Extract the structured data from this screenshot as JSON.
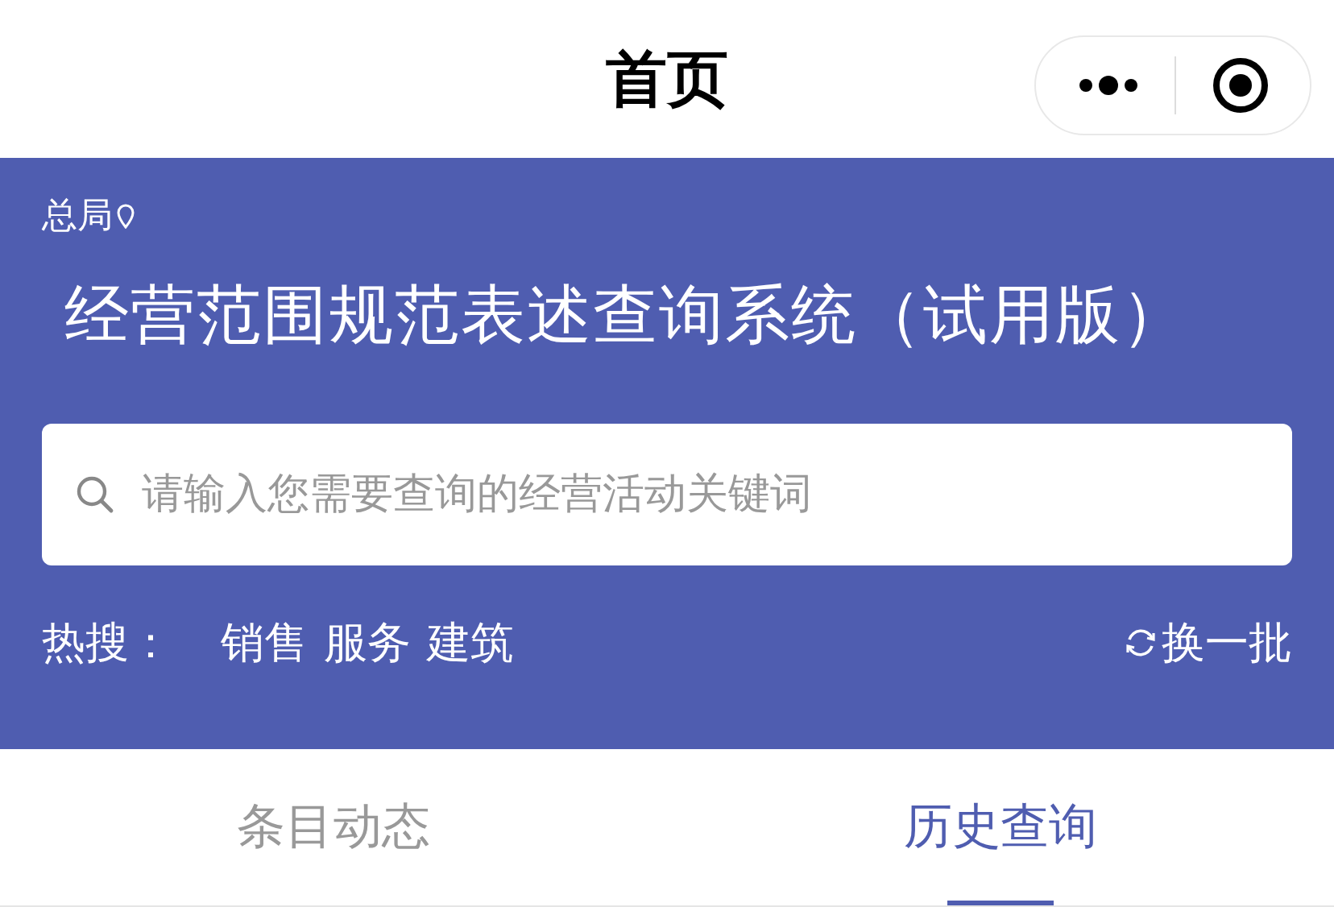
{
  "nav": {
    "title": "首页"
  },
  "header": {
    "location": "总局",
    "title": "经营范围规范表述查询系统（试用版）"
  },
  "search": {
    "placeholder": "请输入您需要查询的经营活动关键词"
  },
  "hot": {
    "label": "热搜：",
    "terms": [
      "销售",
      "服务",
      "建筑"
    ],
    "refresh": "换一批"
  },
  "tabs": [
    {
      "label": "条目动态",
      "selected": false
    },
    {
      "label": "历史查询",
      "selected": true
    }
  ]
}
